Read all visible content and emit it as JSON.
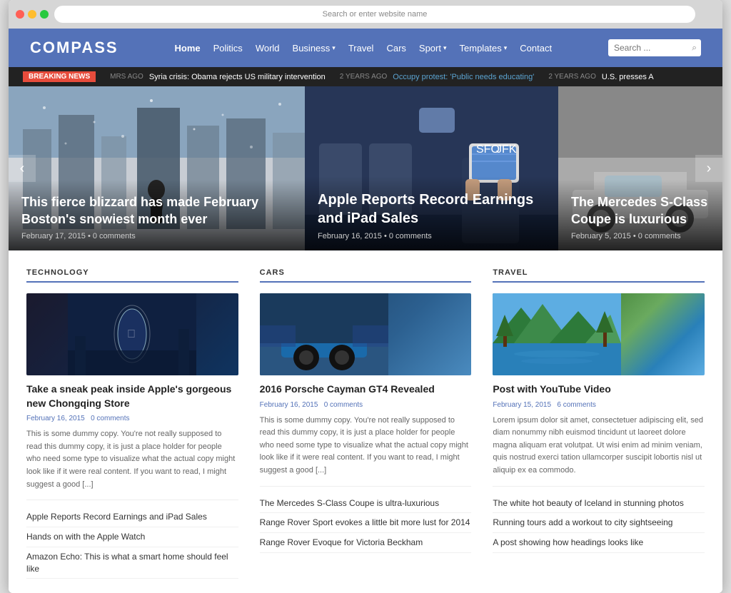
{
  "browser": {
    "url_placeholder": "Search or enter website name"
  },
  "header": {
    "logo": "COMPASS",
    "nav": [
      {
        "label": "Home",
        "active": true,
        "has_dropdown": false
      },
      {
        "label": "Politics",
        "active": false,
        "has_dropdown": false
      },
      {
        "label": "World",
        "active": false,
        "has_dropdown": false
      },
      {
        "label": "Business",
        "active": false,
        "has_dropdown": true
      },
      {
        "label": "Travel",
        "active": false,
        "has_dropdown": false
      },
      {
        "label": "Cars",
        "active": false,
        "has_dropdown": false
      },
      {
        "label": "Sport",
        "active": false,
        "has_dropdown": true
      },
      {
        "label": "Templates",
        "active": false,
        "has_dropdown": true
      },
      {
        "label": "Contact",
        "active": false,
        "has_dropdown": false
      }
    ],
    "search_placeholder": "Search ..."
  },
  "breaking_news": {
    "label": "BREAKING NEWS",
    "items": [
      {
        "time": "MRS AGO",
        "text": "Syria crisis: Obama rejects US military intervention"
      },
      {
        "time": "2 YEARS AGO",
        "text": "Occupy protest: 'Public needs educating'"
      },
      {
        "time": "2 YEARS AGO",
        "text": "U.S. presses A"
      }
    ]
  },
  "slider": {
    "prev_label": "‹",
    "next_label": "›",
    "slides": [
      {
        "title": "This fierce blizzard has made February Boston's snowiest month ever",
        "date": "February 17, 2015",
        "comments": "0 comments",
        "bg_type": "blizzard"
      },
      {
        "title": "Apple Reports Record Earnings and iPad Sales",
        "date": "February 16, 2015",
        "comments": "0 comments",
        "bg_type": "plane"
      },
      {
        "title": "The Mercedes S-Class Coupe is luxurious",
        "date": "February 5, 2015",
        "comments": "0 comments",
        "bg_type": "car"
      }
    ]
  },
  "sections": {
    "technology": {
      "title": "TECHNOLOGY",
      "main_article": {
        "title": "Take a sneak peak inside Apple's gorgeous new Chongqing Store",
        "date": "February 16, 2015",
        "comments": "0 comments",
        "excerpt": "This is some dummy copy. You're not really supposed to read this dummy copy, it is just a place holder for people who need some type to visualize what the actual copy might look like if it were real content. If you want to read, I might suggest a good [...]"
      },
      "related": [
        "Apple Reports Record Earnings and iPad Sales",
        "Hands on with the Apple Watch",
        "Amazon Echo: This is what a smart home should feel like"
      ]
    },
    "cars": {
      "title": "CARS",
      "main_article": {
        "title": "2016 Porsche Cayman GT4 Revealed",
        "date": "February 16, 2015",
        "comments": "0 comments",
        "excerpt": "This is some dummy copy. You're not really supposed to read this dummy copy, it is just a place holder for people who need some type to visualize what the actual copy might look like if it were real content. If you want to read, I might suggest a good [...]"
      },
      "related": [
        "The Mercedes S-Class Coupe is ultra-luxurious",
        "Range Rover Sport evokes a little bit more lust for 2014",
        "Range Rover Evoque for Victoria Beckham"
      ]
    },
    "travel": {
      "title": "TRAVEL",
      "main_article": {
        "title": "Post with YouTube Video",
        "date": "February 15, 2015",
        "comments": "6 comments",
        "excerpt": "Lorem ipsum dolor sit amet, consectetuer adipiscing elit, sed diam nonummy nibh euismod tincidunt ut laoreet dolore magna aliquam erat volutpat. Ut wisi enim ad minim veniam, quis nostrud exerci tation ullamcorper suscipit lobortis nisl ut aliquip ex ea commodo."
      },
      "related": [
        "The white hot beauty of Iceland in stunning photos",
        "Running tours add a workout to city sightseeing",
        "A post showing how headings looks like"
      ]
    }
  }
}
